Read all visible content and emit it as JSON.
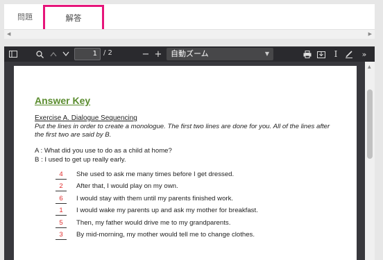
{
  "tabs": [
    {
      "label": "問題"
    },
    {
      "label": "解答"
    }
  ],
  "toolbar": {
    "page_current": "1",
    "page_total": "/ 2",
    "zoom_label": "自動ズーム"
  },
  "doc": {
    "title": "Answer Key",
    "exercise_title": "Exercise A. Dialogue Sequencing",
    "instructions": "Put the lines in order to create a monologue. The first two lines are done for you. All of the lines after the first two are said by B.",
    "line_a": "A : What did you use to do as a child at home?",
    "line_b": "B : I used to get up really early.",
    "answers": [
      {
        "num": "4",
        "text": "She used to ask me many times before I get dressed."
      },
      {
        "num": "2",
        "text": "After that, I would play on my own."
      },
      {
        "num": "6",
        "text": "I would stay with them until my parents finished work."
      },
      {
        "num": "1",
        "text": "I would wake my parents up and ask my mother for breakfast."
      },
      {
        "num": "5",
        "text": "Then, my father would drive me to my grandparents."
      },
      {
        "num": "3",
        "text": "By mid-morning, my mother would tell me to change clothes."
      }
    ]
  },
  "colors": {
    "accent_highlight": "#e6157a",
    "title_green": "#5a8c2e",
    "answer_red": "#e02b2b",
    "viewer_bg": "#38383d",
    "toolbar_bg": "#2a2a2e"
  }
}
